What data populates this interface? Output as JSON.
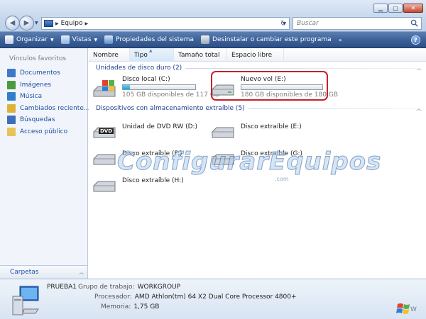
{
  "window": {
    "address_crumb": "Equipo",
    "search_placeholder": "Buscar"
  },
  "toolbar": {
    "organize": "Organizar",
    "views": "Vistas",
    "system_properties": "Propiedades del sistema",
    "uninstall": "Desinstalar o cambiar este programa",
    "more": "»",
    "help": "?"
  },
  "sidebar": {
    "title": "Vínculos favoritos",
    "items": [
      {
        "label": "Documentos",
        "icon": "documents-icon",
        "color": "#3d78c9"
      },
      {
        "label": "Imágenes",
        "icon": "pictures-icon",
        "color": "#4a9a3e"
      },
      {
        "label": "Música",
        "icon": "music-icon",
        "color": "#2f7fc9"
      },
      {
        "label": "Cambiados reciente...",
        "icon": "recent-icon",
        "color": "#e0b13a"
      },
      {
        "label": "Búsquedas",
        "icon": "searches-icon",
        "color": "#3c6fb8"
      },
      {
        "label": "Acceso público",
        "icon": "public-folder-icon",
        "color": "#e7c45a"
      }
    ],
    "folders_label": "Carpetas"
  },
  "columns": [
    "Nombre",
    "Tipo",
    "Tamaño total",
    "Espacio libre"
  ],
  "groups": {
    "hdd": "Unidades de disco duro (2)",
    "removable": "Dispositivos con almacenamiento extraíble (5)"
  },
  "hard_drives": [
    {
      "name": "Disco local (C:)",
      "free_text": "105 GB disponibles de 117 GB",
      "used_fraction": 0.1
    },
    {
      "name": "Nuevo vol (E:)",
      "free_text": "180 GB disponibles de 180 GB",
      "used_fraction": 0.0
    }
  ],
  "removable": [
    {
      "name": "Unidad de DVD RW (D:)",
      "icon": "dvd-drive-icon",
      "badge": "DVD"
    },
    {
      "name": "Disco extraíble (E:)",
      "icon": "removable-disk-icon"
    },
    {
      "name": "Disco extraíble (F:)",
      "icon": "removable-disk-icon"
    },
    {
      "name": "Disco extraíble (G:)",
      "icon": "removable-disk-icon"
    },
    {
      "name": "Disco extraíble (H:)",
      "icon": "removable-disk-icon"
    }
  ],
  "watermark": {
    "text": "ConfigurarEquipos",
    "sub": ".com"
  },
  "details": {
    "computer_name": "PRUEBA1",
    "workgroup_label": "Grupo de trabajo:",
    "workgroup_value": "WORKGROUP",
    "cpu_label": "Procesador:",
    "cpu_value": "AMD Athlon(tm) 64 X2 Dual Core Processor 4800+",
    "memory_label": "Memoria:",
    "memory_value": "1,75 GB"
  },
  "colors": {
    "accent": "#1e4fa0",
    "bar_fill": "#26aee0",
    "highlight": "#c8202a"
  }
}
